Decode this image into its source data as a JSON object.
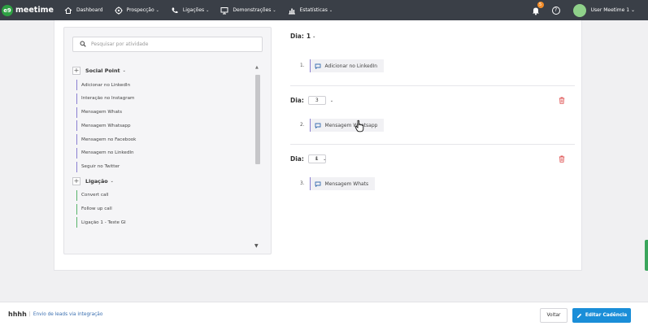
{
  "nav": {
    "logo_mark": "e9",
    "logo_text": "meetime",
    "items": [
      {
        "label": "Dashboard",
        "icon": "home-icon",
        "caret": ""
      },
      {
        "label": "Prospecção",
        "icon": "target-icon",
        "caret": "⌄"
      },
      {
        "label": "Ligações",
        "icon": "phone-icon",
        "caret": "⌄"
      },
      {
        "label": "Demonstrações",
        "icon": "monitor-icon",
        "caret": "⌄"
      },
      {
        "label": "Estatísticas",
        "icon": "bar-chart-icon",
        "caret": "⌄"
      }
    ],
    "notification_count": "5",
    "help_symbol": "?",
    "user_name": "User Meetime 1 ⌄"
  },
  "activity_panel": {
    "search_placeholder": "Pesquisar por atividade",
    "groups": [
      {
        "title": "Social Point",
        "plus": "+",
        "items": [
          "Adicionar no LinkedIn",
          "Interação no Instagram",
          "Mensagem Whats",
          "Mensagem Whatsapp",
          "Mensagem no Facebook",
          "Mensagem no LinkedIn",
          "Seguir no Twitter"
        ]
      },
      {
        "title": "Ligação",
        "plus": "+",
        "items": [
          "Convert call",
          "Follow up call",
          "Ligação 1 - Teste GI"
        ]
      }
    ]
  },
  "cadence": {
    "day_label": "Dia:",
    "days": [
      {
        "value": "1",
        "step_number": "1.",
        "step_label": "Adicionar no LinkedIn"
      },
      {
        "value": "3",
        "step_number": "2.",
        "step_label": "Mensagem Whatsapp"
      },
      {
        "value": "1",
        "step_number": "3.",
        "step_label": "Mensagem Whats"
      }
    ]
  },
  "bottom": {
    "title": "hhhh",
    "separator": "|",
    "subtitle": "Envio de leads via integração",
    "back_label": "Voltar",
    "edit_label": "Editar Cadência"
  },
  "colors": {
    "nav_bg": "#3a3f47",
    "accent_blue": "#1a8ed8",
    "social_purple": "#8a7fd1",
    "call_green": "#58b36a",
    "danger_red": "#e05a5a",
    "badge_orange": "#f28c28"
  }
}
